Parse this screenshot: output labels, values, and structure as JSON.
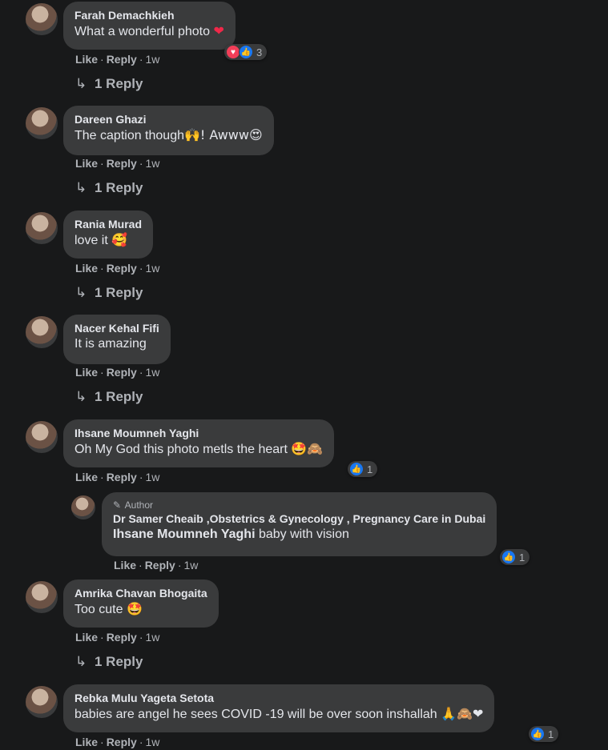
{
  "comments": [
    {
      "name": "Farah Demachkieh",
      "text": "What a wonderful photo",
      "emoji": "❤",
      "actions": {
        "like": "Like",
        "reply": "Reply",
        "time": "1w"
      },
      "reactions": {
        "icons": [
          "love",
          "like"
        ],
        "count": "3"
      },
      "view_replies": "1 Reply"
    },
    {
      "name": "Dareen Ghazi",
      "text": "The caption though",
      "emoji": "🙌! Awww😍",
      "actions": {
        "like": "Like",
        "reply": "Reply",
        "time": "1w"
      },
      "view_replies": "1 Reply"
    },
    {
      "name": "Rania Murad",
      "text": "love it",
      "emoji": "🥰",
      "actions": {
        "like": "Like",
        "reply": "Reply",
        "time": "1w"
      },
      "view_replies": "1 Reply"
    },
    {
      "name": "Nacer Kehal Fifi",
      "text": "It is amazing",
      "emoji": "",
      "actions": {
        "like": "Like",
        "reply": "Reply",
        "time": "1w"
      },
      "view_replies": "1 Reply"
    },
    {
      "name": "Ihsane Moumneh Yaghi",
      "text": "Oh My God this photo metls the heart",
      "emoji": "🤩🙈",
      "actions": {
        "like": "Like",
        "reply": "Reply",
        "time": "1w"
      },
      "reactions": {
        "icons": [
          "like"
        ],
        "count": "1"
      }
    },
    {
      "name": "Amrika Chavan Bhogaita",
      "text": "Too cute",
      "emoji": "🤩",
      "actions": {
        "like": "Like",
        "reply": "Reply",
        "time": "1w"
      },
      "view_replies": "1 Reply"
    },
    {
      "name": "Rebka Mulu Yageta Setota",
      "text": "babies are angel he sees COVID -19 will be over soon inshallah",
      "emoji": "🙏🙈❤",
      "actions": {
        "like": "Like",
        "reply": "Reply",
        "time": "1w"
      },
      "reactions": {
        "icons": [
          "like"
        ],
        "count": "1"
      }
    }
  ],
  "author_reply": {
    "badge": "Author",
    "name": "Dr Samer Cheaib ,Obstetrics & Gynecology , Pregnancy Care in Dubai",
    "mention": "Ihsane Moumneh Yaghi",
    "text": " baby with vision",
    "actions": {
      "like": "Like",
      "reply": "Reply",
      "time": "1w"
    },
    "reactions": {
      "icons": [
        "like"
      ],
      "count": "1"
    }
  },
  "colors": {
    "background": "#18191a",
    "bubble": "#3a3b3c",
    "text": "#e4e6eb",
    "secondary": "#b0b3b8",
    "like_blue": "#1877f2",
    "love_red": "#f33e58"
  },
  "icons": {
    "reply_arrow": "reply-arrow-icon",
    "author_pen": "pencil-icon"
  }
}
